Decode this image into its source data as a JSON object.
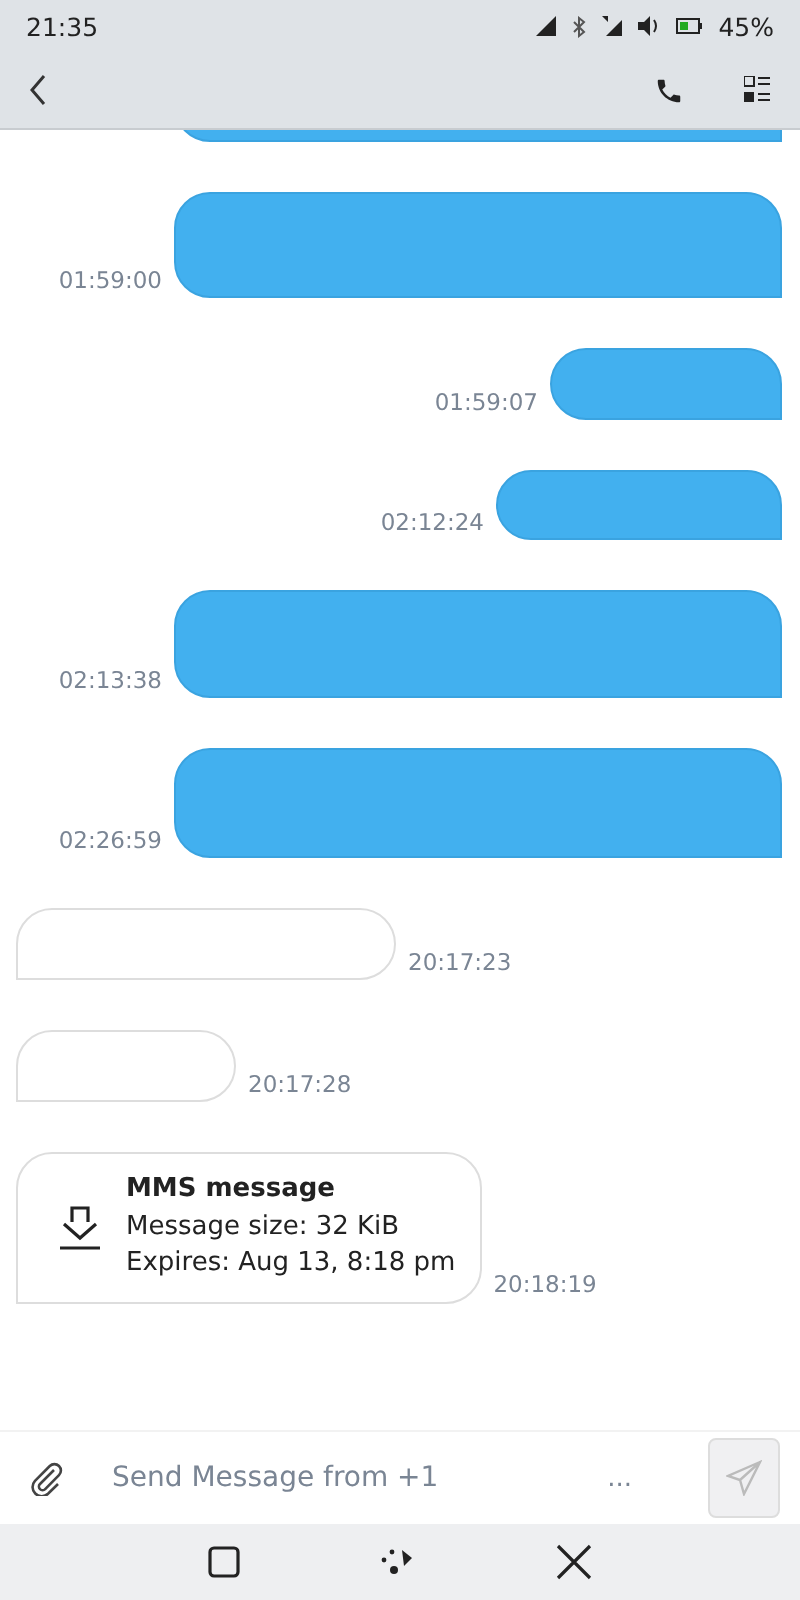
{
  "status_bar": {
    "time": "21:35",
    "battery": "45%"
  },
  "messages": [
    {
      "kind": "sent"
    },
    {
      "kind": "sent",
      "time": "01:59:00"
    },
    {
      "kind": "sent",
      "time": "01:59:07"
    },
    {
      "kind": "sent",
      "time": "02:12:24"
    },
    {
      "kind": "sent",
      "time": "02:13:38"
    },
    {
      "kind": "sent",
      "time": "02:26:59"
    },
    {
      "kind": "received",
      "time": "20:17:23"
    },
    {
      "kind": "received",
      "time": "20:17:28"
    },
    {
      "kind": "mms",
      "time": "20:18:19",
      "title": "MMS message",
      "size": "Message size: 32 KiB",
      "expires": "Expires: Aug 13, 8:18 pm"
    }
  ],
  "composer": {
    "placeholder": "Send Message from +1",
    "more": "..."
  }
}
